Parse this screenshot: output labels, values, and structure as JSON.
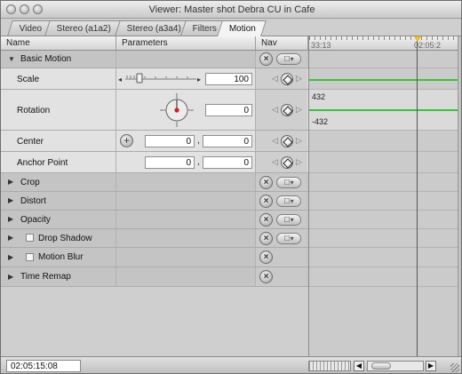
{
  "window": {
    "title": "Viewer: Master shot Debra CU in Cafe"
  },
  "tabs": [
    {
      "label": "Video"
    },
    {
      "label": "Stereo (a1a2)"
    },
    {
      "label": "Stereo (a3a4)"
    },
    {
      "label": "Filters"
    },
    {
      "label": "Motion",
      "active": true
    }
  ],
  "columns": {
    "name": "Name",
    "parameters": "Parameters",
    "nav": "Nav"
  },
  "timeline": {
    "ruler_start": "33:13",
    "ruler_end": "02:05:2",
    "rotation_max": "432",
    "rotation_min": "-432"
  },
  "rows": {
    "basic_motion": {
      "label": "Basic Motion"
    },
    "scale": {
      "label": "Scale",
      "value": "100"
    },
    "rotation": {
      "label": "Rotation",
      "value": "0"
    },
    "center": {
      "label": "Center",
      "x": "0",
      "y": "0"
    },
    "anchor": {
      "label": "Anchor Point",
      "x": "0",
      "y": "0"
    },
    "crop": {
      "label": "Crop"
    },
    "distort": {
      "label": "Distort"
    },
    "opacity": {
      "label": "Opacity"
    },
    "drop_shadow": {
      "label": "Drop Shadow"
    },
    "motion_blur": {
      "label": "Motion Blur"
    },
    "time_remap": {
      "label": "Time Remap"
    }
  },
  "footer": {
    "timecode": "02:05:15:08"
  },
  "icons": {
    "reset": "reset-x-icon",
    "menu": "parameter-menu-icon",
    "keyframe": "keyframe-diamond-icon"
  },
  "colors": {
    "keyframe_line": "#3fbf3f",
    "playhead_marker": "#e8c42a",
    "rotation_handle": "#cc1f1f"
  }
}
